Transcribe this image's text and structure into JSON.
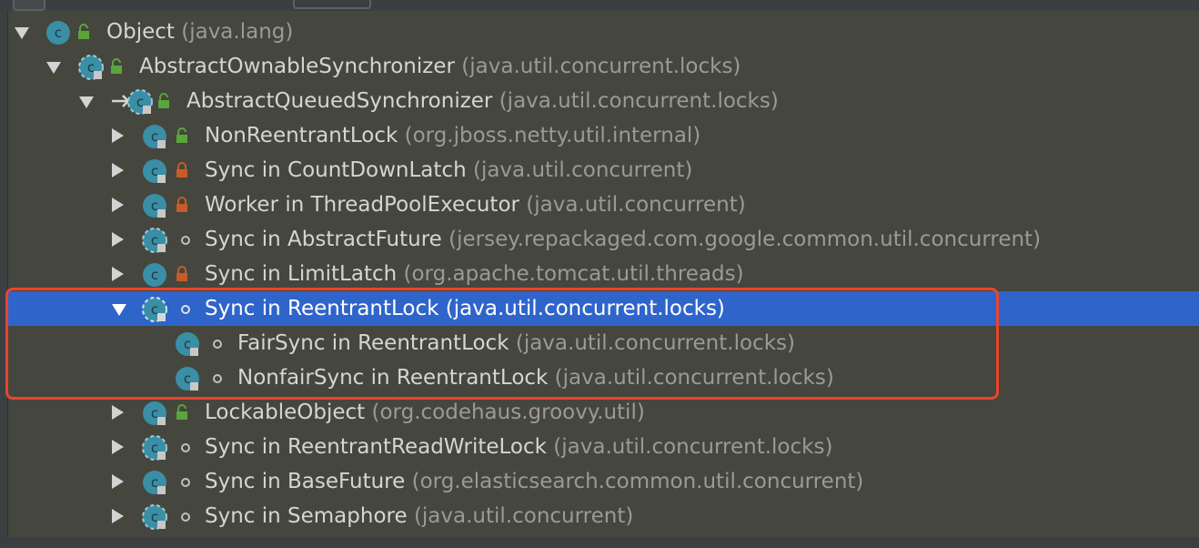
{
  "hierarchy": {
    "rows": [
      {
        "name": "Object",
        "pkg": "(java.lang)",
        "expanded": true,
        "access": "public"
      },
      {
        "name": "AbstractOwnableSynchronizer",
        "pkg": "(java.util.concurrent.locks)",
        "expanded": true,
        "access": "public"
      },
      {
        "name": "AbstractQueuedSynchronizer",
        "pkg": "(java.util.concurrent.locks)",
        "expanded": true,
        "access": "public"
      },
      {
        "name": "NonReentrantLock",
        "pkg": "(org.jboss.netty.util.internal)",
        "expanded": false,
        "access": "public"
      },
      {
        "name": "Sync in CountDownLatch",
        "pkg": "(java.util.concurrent)",
        "expanded": false,
        "access": "private"
      },
      {
        "name": "Worker in ThreadPoolExecutor",
        "pkg": "(java.util.concurrent)",
        "expanded": false,
        "access": "private"
      },
      {
        "name": "Sync in AbstractFuture",
        "pkg": "(jersey.repackaged.com.google.common.util.concurrent)",
        "expanded": false,
        "access": "package"
      },
      {
        "name": "Sync in LimitLatch",
        "pkg": "(org.apache.tomcat.util.threads)",
        "expanded": false,
        "access": "private"
      },
      {
        "name": "Sync in ReentrantLock",
        "pkg": "(java.util.concurrent.locks)",
        "expanded": true,
        "access": "package",
        "selected": true
      },
      {
        "name": "FairSync in ReentrantLock",
        "pkg": "(java.util.concurrent.locks)",
        "access": "package"
      },
      {
        "name": "NonfairSync in ReentrantLock",
        "pkg": "(java.util.concurrent.locks)",
        "access": "package"
      },
      {
        "name": "LockableObject",
        "pkg": "(org.codehaus.groovy.util)",
        "expanded": false,
        "access": "public"
      },
      {
        "name": "Sync in ReentrantReadWriteLock",
        "pkg": "(java.util.concurrent.locks)",
        "expanded": false,
        "access": "package"
      },
      {
        "name": "Sync in BaseFuture",
        "pkg": "(org.elasticsearch.common.util.concurrent)",
        "expanded": false,
        "access": "package"
      },
      {
        "name": "Sync in Semaphore",
        "pkg": "(java.util.concurrent)",
        "expanded": false,
        "access": "package"
      }
    ]
  },
  "colors": {
    "selection": "#2f65ca",
    "highlight_border": "#e8452e",
    "public_lock": "#5aa53b",
    "private_lock": "#c75b2a",
    "class_icon": "#3a8ea5"
  }
}
